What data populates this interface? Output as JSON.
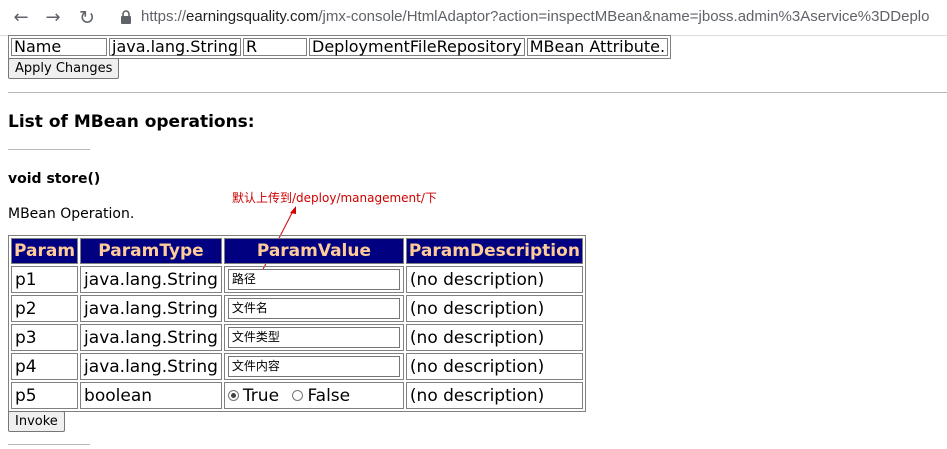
{
  "browser": {
    "url_scheme": "https://",
    "url_host": "earningsquality.com",
    "url_path": "/jmx-console/HtmlAdaptor?action=inspectMBean&name=jboss.admin%3Aservice%3DDeplo"
  },
  "attribute_row": [
    "Name",
    "java.lang.String",
    "R",
    "DeploymentFileRepository",
    "MBean Attribute."
  ],
  "apply_button": "Apply Changes",
  "operations_heading": "List of MBean operations:",
  "operation": {
    "signature": "void store()",
    "description": "MBean Operation.",
    "annotation": "默认上传到/deploy/management/下",
    "annotation_color": "#d00000",
    "headers": [
      "Param",
      "ParamType",
      "ParamValue",
      "ParamDescription"
    ],
    "header_bg": "#000080",
    "header_fg": "#ffcc99",
    "params": [
      {
        "name": "p1",
        "type": "java.lang.String",
        "value": "路径",
        "desc": "(no description)"
      },
      {
        "name": "p2",
        "type": "java.lang.String",
        "value": "文件名",
        "desc": "(no description)"
      },
      {
        "name": "p3",
        "type": "java.lang.String",
        "value": "文件类型",
        "desc": "(no description)"
      },
      {
        "name": "p4",
        "type": "java.lang.String",
        "value": "文件内容",
        "desc": "(no description)"
      }
    ],
    "bool_param": {
      "name": "p5",
      "type": "boolean",
      "true_label": "True",
      "false_label": "False",
      "selected": "True",
      "desc": "(no description)"
    },
    "invoke_button": "Invoke"
  },
  "icons": [
    "back-arrow-icon",
    "forward-arrow-icon",
    "reload-icon",
    "lock-icon"
  ]
}
